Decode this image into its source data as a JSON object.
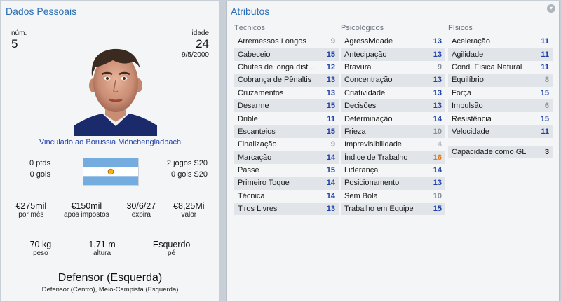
{
  "personal": {
    "title": "Dados Pessoais",
    "num_label": "núm.",
    "num_value": "5",
    "age_label": "idade",
    "age_value": "24",
    "dob": "9/5/2000",
    "club": "Vinculado ao Borussia Mönchengladbach",
    "points": "0 ptds",
    "goals": "0 gols",
    "games": "2 jogos S20",
    "goals_s20": "0 gols S20",
    "wage_value": "€275mil",
    "wage_label": "por mês",
    "net_value": "€150mil",
    "net_label": "após impostos",
    "expires_value": "30/6/27",
    "expires_label": "expira",
    "value_value": "€8,25Mi",
    "value_label": "valor",
    "weight_value": "70 kg",
    "weight_label": "peso",
    "height_value": "1.71 m",
    "height_label": "altura",
    "foot_value": "Esquerdo",
    "foot_label": "pé",
    "position": "Defensor (Esquerda)",
    "other_positions": "Defensor (Centro), Meio-Campista (Esquerda)"
  },
  "attributes": {
    "title": "Atributos",
    "technical_head": "Técnicos",
    "mental_head": "Psicológicos",
    "physical_head": "Físicos",
    "technical": [
      {
        "label": "Arremessos Longos",
        "value": "9",
        "tier": "mid"
      },
      {
        "label": "Cabeceio",
        "value": "15",
        "tier": "high"
      },
      {
        "label": "Chutes de longa dist...",
        "value": "12",
        "tier": "high"
      },
      {
        "label": "Cobrança de Pênaltis",
        "value": "13",
        "tier": "high"
      },
      {
        "label": "Cruzamentos",
        "value": "13",
        "tier": "high"
      },
      {
        "label": "Desarme",
        "value": "15",
        "tier": "high"
      },
      {
        "label": "Drible",
        "value": "11",
        "tier": "high"
      },
      {
        "label": "Escanteios",
        "value": "15",
        "tier": "high"
      },
      {
        "label": "Finalização",
        "value": "9",
        "tier": "mid"
      },
      {
        "label": "Marcação",
        "value": "14",
        "tier": "high"
      },
      {
        "label": "Passe",
        "value": "15",
        "tier": "high"
      },
      {
        "label": "Primeiro Toque",
        "value": "14",
        "tier": "high"
      },
      {
        "label": "Técnica",
        "value": "14",
        "tier": "high"
      },
      {
        "label": "Tiros Livres",
        "value": "13",
        "tier": "high"
      }
    ],
    "mental": [
      {
        "label": "Agressividade",
        "value": "13",
        "tier": "high"
      },
      {
        "label": "Antecipação",
        "value": "13",
        "tier": "high"
      },
      {
        "label": "Bravura",
        "value": "9",
        "tier": "mid"
      },
      {
        "label": "Concentração",
        "value": "13",
        "tier": "high"
      },
      {
        "label": "Criatividade",
        "value": "13",
        "tier": "high"
      },
      {
        "label": "Decisões",
        "value": "13",
        "tier": "high"
      },
      {
        "label": "Determinação",
        "value": "14",
        "tier": "high"
      },
      {
        "label": "Frieza",
        "value": "10",
        "tier": "mid"
      },
      {
        "label": "Imprevisibilidade",
        "value": "4",
        "tier": "low"
      },
      {
        "label": "Índice de Trabalho",
        "value": "16",
        "tier": "top"
      },
      {
        "label": "Liderança",
        "value": "14",
        "tier": "high"
      },
      {
        "label": "Posicionamento",
        "value": "13",
        "tier": "high"
      },
      {
        "label": "Sem Bola",
        "value": "10",
        "tier": "mid"
      },
      {
        "label": "Trabalho em Equipe",
        "value": "15",
        "tier": "high"
      }
    ],
    "physical": [
      {
        "label": "Aceleração",
        "value": "11",
        "tier": "high"
      },
      {
        "label": "Agilidade",
        "value": "11",
        "tier": "high"
      },
      {
        "label": "Cond. Física Natural",
        "value": "11",
        "tier": "high"
      },
      {
        "label": "Equilíbrio",
        "value": "8",
        "tier": "mid"
      },
      {
        "label": "Força",
        "value": "15",
        "tier": "high"
      },
      {
        "label": "Impulsão",
        "value": "6",
        "tier": "mid"
      },
      {
        "label": "Resistência",
        "value": "15",
        "tier": "high"
      },
      {
        "label": "Velocidade",
        "value": "11",
        "tier": "high"
      }
    ],
    "gk_label": "Capacidade como GL",
    "gk_value": "3"
  },
  "colors": {
    "accent": "#2a6db5",
    "value_high": "#1c3fa8",
    "value_top": "#e07b1a",
    "value_mid": "#8b9096",
    "value_low": "#b8bcc1"
  },
  "icons": {
    "collapse": "chevron-down-icon",
    "flag": "argentina-flag",
    "avatar": "player-face"
  }
}
